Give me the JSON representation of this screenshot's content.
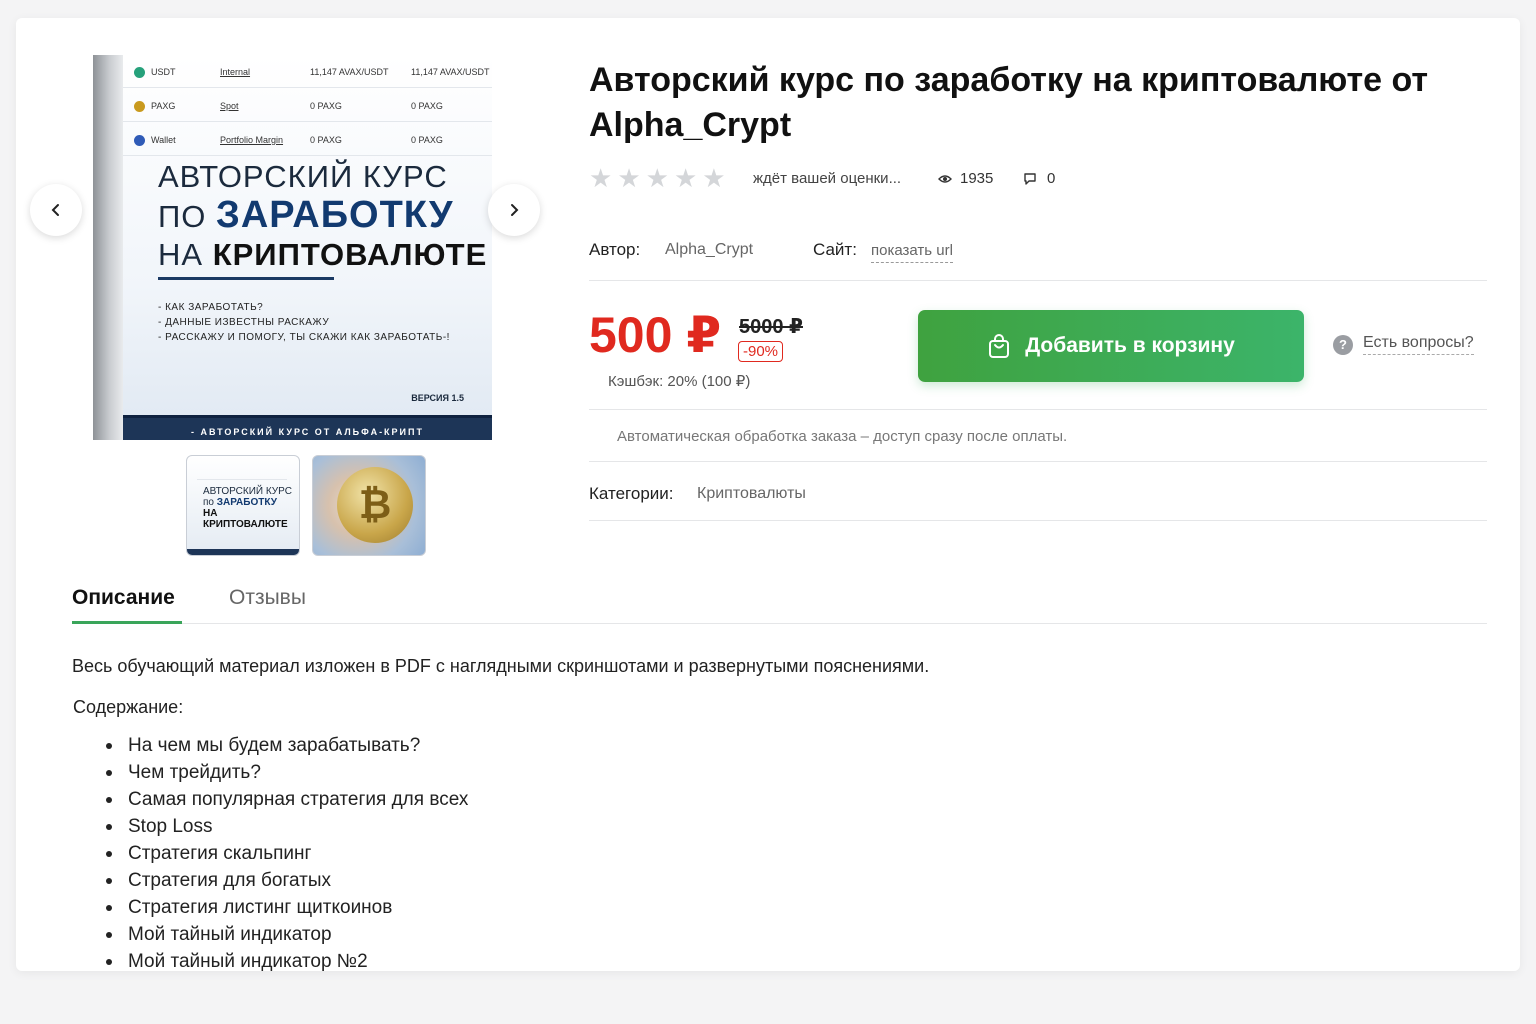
{
  "product": {
    "title": "Авторский курс по заработку на криптовалюте от Alpha_Crypt",
    "rating_text": "ждёт вашей оценки...",
    "views": "1935",
    "comments": "0",
    "author_label": "Автор:",
    "author_value": "Alpha_Crypt",
    "site_label": "Сайт:",
    "site_link": "показать url",
    "price": "500 ₽",
    "old_price": "5000 ₽",
    "discount": "-90%",
    "cashback": "Кэшбэк: 20% (100 ₽)",
    "add_to_cart": "Добавить в корзину",
    "questions": "Есть вопросы?",
    "auto_note": "Автоматическая обработка заказа – доступ сразу после оплаты.",
    "categories_label": "Категории:",
    "category": "Криптовалюты"
  },
  "cover": {
    "rows": [
      {
        "coin": "USDT",
        "type": "Internal",
        "a": "11,147 AVAX/USDT",
        "b": "11,147 AVAX/USDT",
        "color": "#26a17b"
      },
      {
        "coin": "PAXG",
        "type": "Spot",
        "a": "0 PAXG",
        "b": "0 PAXG",
        "color": "#c99a1e"
      },
      {
        "coin": "Wallet",
        "type": "Portfolio Margin",
        "a": "0 PAXG",
        "b": "0 PAXG",
        "color": "#2f5bb7"
      }
    ],
    "line1": "АВТОРСКИЙ КУРС",
    "line2_prefix": "ПО ",
    "line2_bold": "ЗАРАБОТКУ",
    "line3_prefix": "НА ",
    "line3_bold": "КРИПТОВАЛЮТЕ",
    "bullets": [
      "- КАК ЗАРАБОТАТЬ?",
      "- ДАННЫЕ ИЗВЕСТНЫ РАСКАЖУ",
      "- РАССКАЖУ И ПОМОГУ, ТЫ СКАЖИ КАК ЗАРАБОТАТЬ-!"
    ],
    "version": "ВЕРСИЯ 1.5",
    "band": "- АВТОРСКИЙ КУРС ОТ АЛЬФА-КРИПТ"
  },
  "thumb1": {
    "line1": "АВТОРСКИЙ КУРС",
    "line2_prefix": "по ",
    "line2_bold": "ЗАРАБОТКУ",
    "line3": "НА КРИПТОВАЛЮТЕ"
  },
  "tabs": [
    "Описание",
    "Отзывы"
  ],
  "description": {
    "intro": "Весь обучающий материал изложен в PDF с наглядными скриншотами и развернутыми пояснениями.",
    "contents_title": "Содержание:",
    "items": [
      "На чем мы будем зарабатывать?",
      "Чем трейдить?",
      "Самая популярная стратегия для всех",
      "Stop Loss",
      "Стратегия скальпинг",
      "Стратегия для богатых",
      "Стратегия листинг щиткоинов",
      "Мой тайный индикатор",
      "Мой тайный индикатор №2"
    ]
  },
  "colors": {
    "price": "#e0291f",
    "cart_button": "#3fa23f",
    "tab_accent": "#3aa55a"
  },
  "icons": [
    "chevron-left-icon",
    "chevron-right-icon",
    "eye-icon",
    "comment-icon",
    "shopping-bag-icon",
    "question-icon",
    "star-icon"
  ]
}
